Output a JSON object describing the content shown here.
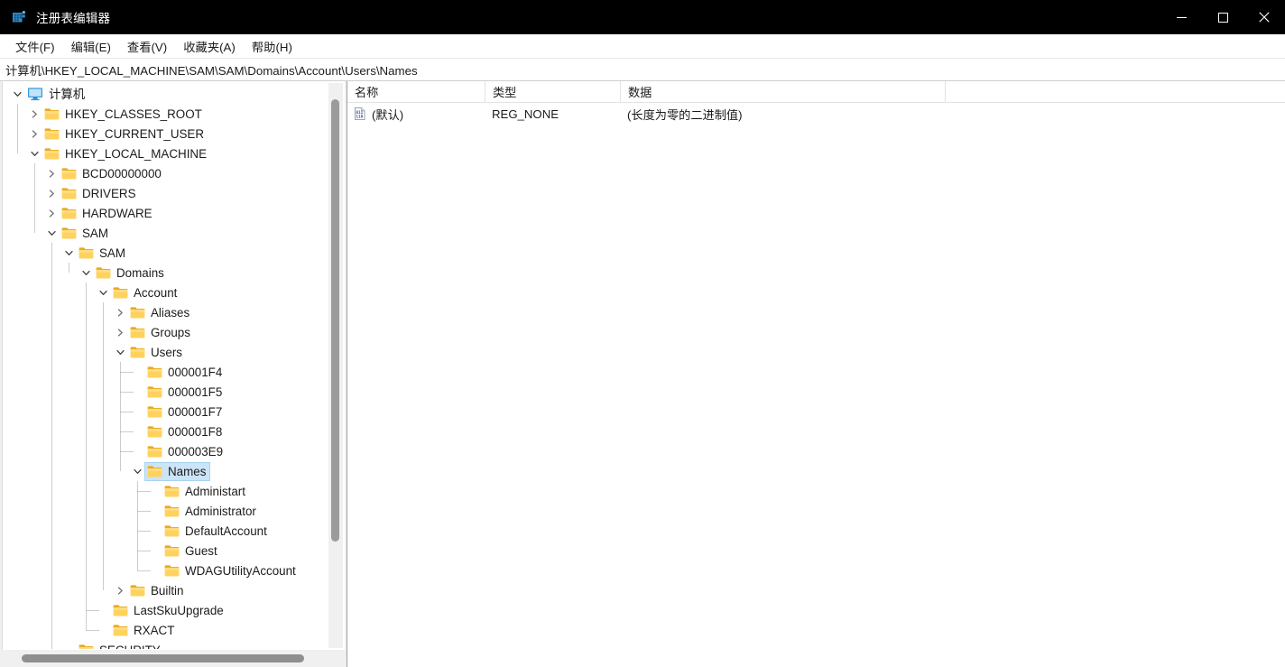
{
  "window": {
    "title": "注册表编辑器",
    "app_icon": "registry-editor-icon",
    "controls": {
      "minimize": "最小化",
      "maximize": "最大化",
      "close": "关闭"
    }
  },
  "menubar": {
    "items": [
      {
        "label": "文件(F)",
        "name": "menu-file"
      },
      {
        "label": "编辑(E)",
        "name": "menu-edit"
      },
      {
        "label": "查看(V)",
        "name": "menu-view"
      },
      {
        "label": "收藏夹(A)",
        "name": "menu-favorites"
      },
      {
        "label": "帮助(H)",
        "name": "menu-help"
      }
    ]
  },
  "address": {
    "path": "计算机\\HKEY_LOCAL_MACHINE\\SAM\\SAM\\Domains\\Account\\Users\\Names"
  },
  "tree": {
    "nodes": [
      {
        "label": "计算机",
        "depth": 0,
        "icon": "computer-icon",
        "state": "expanded",
        "selected": false
      },
      {
        "label": "HKEY_CLASSES_ROOT",
        "depth": 1,
        "icon": "folder-icon",
        "state": "collapsed",
        "selected": false
      },
      {
        "label": "HKEY_CURRENT_USER",
        "depth": 1,
        "icon": "folder-icon",
        "state": "collapsed",
        "selected": false
      },
      {
        "label": "HKEY_LOCAL_MACHINE",
        "depth": 1,
        "icon": "folder-icon",
        "state": "expanded",
        "selected": false
      },
      {
        "label": "BCD00000000",
        "depth": 2,
        "icon": "folder-icon",
        "state": "collapsed",
        "selected": false
      },
      {
        "label": "DRIVERS",
        "depth": 2,
        "icon": "folder-icon",
        "state": "collapsed",
        "selected": false
      },
      {
        "label": "HARDWARE",
        "depth": 2,
        "icon": "folder-icon",
        "state": "collapsed",
        "selected": false
      },
      {
        "label": "SAM",
        "depth": 2,
        "icon": "folder-icon",
        "state": "expanded",
        "selected": false
      },
      {
        "label": "SAM",
        "depth": 3,
        "icon": "folder-icon",
        "state": "expanded",
        "selected": false
      },
      {
        "label": "Domains",
        "depth": 4,
        "icon": "folder-icon",
        "state": "expanded",
        "selected": false
      },
      {
        "label": "Account",
        "depth": 5,
        "icon": "folder-icon",
        "state": "expanded",
        "selected": false
      },
      {
        "label": "Aliases",
        "depth": 6,
        "icon": "folder-icon",
        "state": "collapsed",
        "selected": false
      },
      {
        "label": "Groups",
        "depth": 6,
        "icon": "folder-icon",
        "state": "collapsed",
        "selected": false
      },
      {
        "label": "Users",
        "depth": 6,
        "icon": "folder-icon",
        "state": "expanded",
        "selected": false
      },
      {
        "label": "000001F4",
        "depth": 7,
        "icon": "folder-icon",
        "state": "leaf",
        "selected": false
      },
      {
        "label": "000001F5",
        "depth": 7,
        "icon": "folder-icon",
        "state": "leaf",
        "selected": false
      },
      {
        "label": "000001F7",
        "depth": 7,
        "icon": "folder-icon",
        "state": "leaf",
        "selected": false
      },
      {
        "label": "000001F8",
        "depth": 7,
        "icon": "folder-icon",
        "state": "leaf",
        "selected": false
      },
      {
        "label": "000003E9",
        "depth": 7,
        "icon": "folder-icon",
        "state": "leaf",
        "selected": false
      },
      {
        "label": "Names",
        "depth": 7,
        "icon": "folder-icon",
        "state": "expanded",
        "selected": true
      },
      {
        "label": "Administart",
        "depth": 8,
        "icon": "folder-icon",
        "state": "leaf",
        "selected": false
      },
      {
        "label": "Administrator",
        "depth": 8,
        "icon": "folder-icon",
        "state": "leaf",
        "selected": false
      },
      {
        "label": "DefaultAccount",
        "depth": 8,
        "icon": "folder-icon",
        "state": "leaf",
        "selected": false
      },
      {
        "label": "Guest",
        "depth": 8,
        "icon": "folder-icon",
        "state": "leaf",
        "selected": false
      },
      {
        "label": "WDAGUtilityAccount",
        "depth": 8,
        "icon": "folder-icon",
        "state": "leaf",
        "selected": false
      },
      {
        "label": "Builtin",
        "depth": 6,
        "icon": "folder-icon",
        "state": "collapsed",
        "selected": false
      },
      {
        "label": "LastSkuUpgrade",
        "depth": 5,
        "icon": "folder-icon",
        "state": "leaf",
        "selected": false
      },
      {
        "label": "RXACT",
        "depth": 5,
        "icon": "folder-icon",
        "state": "leaf",
        "selected": false
      },
      {
        "label": "SECURITY",
        "depth": 3,
        "icon": "folder-icon",
        "state": "leaf",
        "selected": false
      }
    ]
  },
  "list": {
    "columns": [
      {
        "label": "名称",
        "name": "column-name"
      },
      {
        "label": "类型",
        "name": "column-type"
      },
      {
        "label": "数据",
        "name": "column-data"
      }
    ],
    "rows": [
      {
        "icon": "binary-value-icon",
        "name": "(默认)",
        "type": "REG_NONE",
        "data": "(长度为零的二进制值)"
      }
    ]
  },
  "colors": {
    "titlebar_bg": "#000000",
    "titlebar_fg": "#ffffff",
    "folder_yellow": "#ffd04b",
    "folder_yellow_dark": "#f0b428",
    "selection_bg": "#cce4f7",
    "selection_border": "#a8d3f0",
    "computer_blue": "#2b8fd8",
    "scrollbar_thumb": "#9b9b9b"
  }
}
